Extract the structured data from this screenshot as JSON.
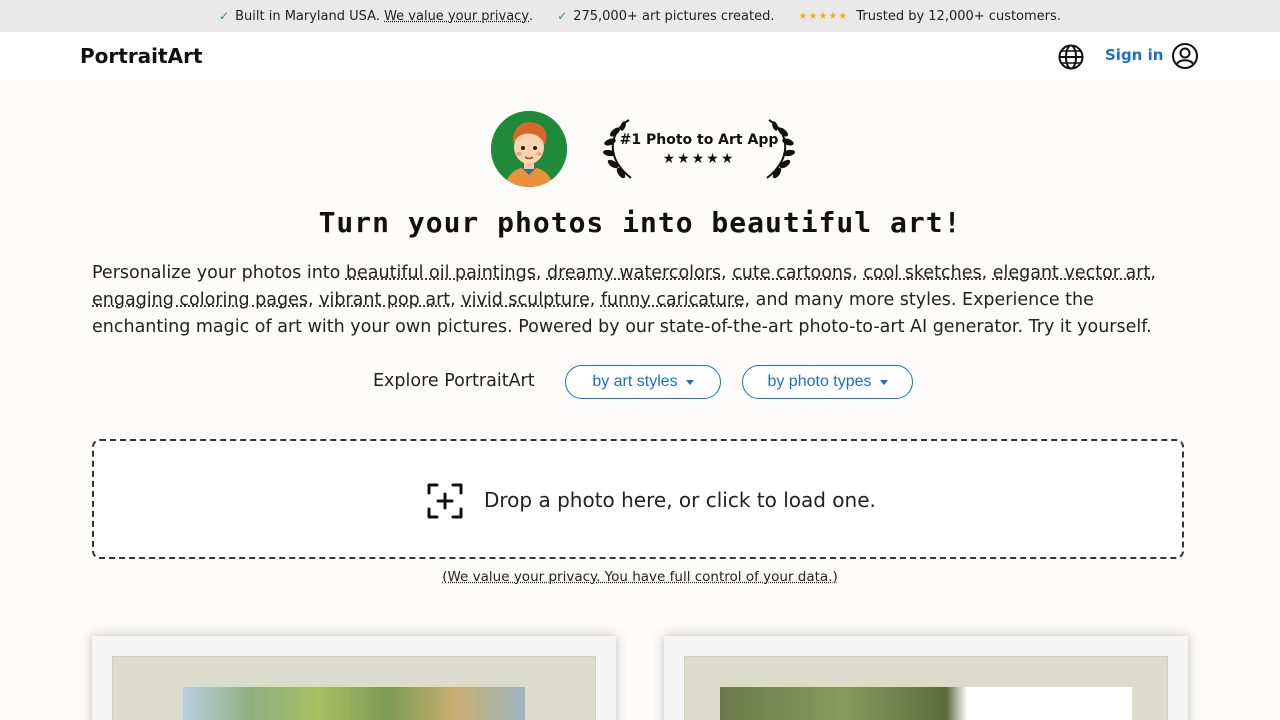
{
  "topbar": {
    "item1_text": "Built in Maryland USA.",
    "item1_link": "We value your privacy",
    "item1_suffix": ".",
    "item2_text": "275,000+ art pictures created.",
    "item3_stars": "★★★★★",
    "item3_text": "Trusted by 12,000+ customers.",
    "check_glyph": "✓"
  },
  "navbar": {
    "brand": "PortraitArt",
    "signin": "Sign in"
  },
  "award": {
    "title": "#1 Photo to Art App",
    "stars": "★★★★★"
  },
  "headline": "Turn your photos into beautiful art!",
  "intro": {
    "lead": "Personalize your photos into ",
    "styles": [
      "beautiful oil paintings",
      "dreamy watercolors",
      "cute cartoons",
      "cool sketches",
      "elegant vector art",
      "engaging coloring pages",
      "vibrant pop art",
      "vivid sculpture",
      "funny caricature"
    ],
    "tail": ", and many more styles. Experience the enchanting magic of art with your own pictures. Powered by our state-of-the-art photo-to-art AI generator. Try it yourself."
  },
  "explore": {
    "label": "Explore PortraitArt",
    "by_styles": "by art styles",
    "by_types": "by photo types"
  },
  "dropzone": {
    "text": "Drop a photo here, or click to load one."
  },
  "privacy_note": "(We value your privacy. You have full control of your data.)",
  "colors": {
    "accent": "#1a6fc9",
    "check": "#2e9b3e",
    "star": "#f0b020",
    "avatar_bg": "#1e8a3a"
  }
}
